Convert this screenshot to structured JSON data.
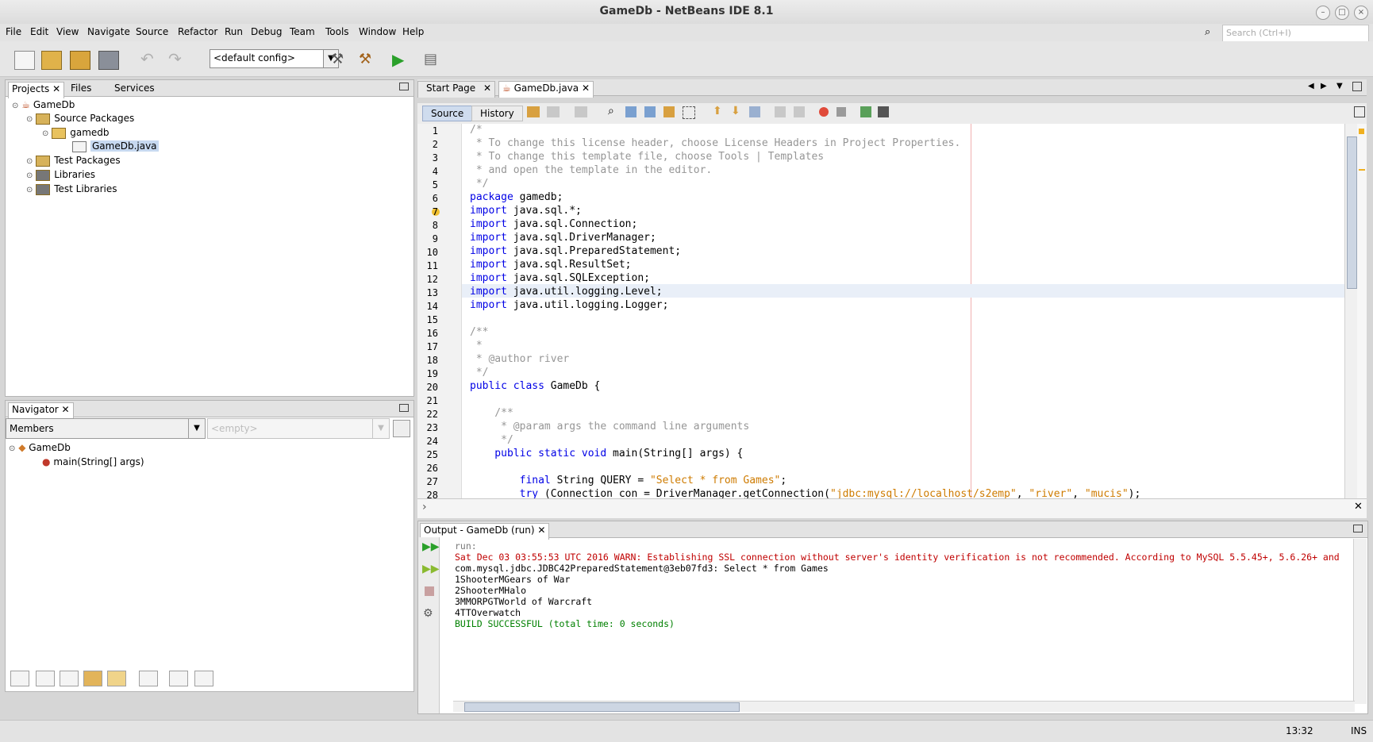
{
  "window": {
    "title": "GameDb - NetBeans IDE 8.1"
  },
  "menu": [
    "File",
    "Edit",
    "View",
    "Navigate",
    "Source",
    "Refactor",
    "Run",
    "Debug",
    "Team",
    "Tools",
    "Window",
    "Help"
  ],
  "search": {
    "placeholder": "Search (Ctrl+I)"
  },
  "toolbar": {
    "config": "<default config>"
  },
  "projects_panel": {
    "tabs": [
      "Projects",
      "Files",
      "Services"
    ],
    "tree": [
      "GameDb",
      "Source Packages",
      "gamedb",
      "GameDb.java",
      "Test Packages",
      "Libraries",
      "Test Libraries"
    ]
  },
  "navigator": {
    "title": "Navigator",
    "filter": "Members",
    "empty": "<empty>",
    "tree": [
      "GameDb",
      "main(String[] args)"
    ]
  },
  "editor": {
    "tabs": [
      "Start Page",
      "GameDb.java"
    ],
    "modes": [
      "Source",
      "History"
    ],
    "line_numbers": [
      "1",
      "2",
      "3",
      "4",
      "5",
      "6",
      "7",
      "8",
      "9",
      "10",
      "11",
      "12",
      "13",
      "14",
      "15",
      "16",
      "17",
      "18",
      "19",
      "20",
      "21",
      "22",
      "23",
      "24",
      "25",
      "26",
      "27",
      "28"
    ]
  },
  "code": [
    [
      {
        "t": "/*",
        "c": "cm"
      }
    ],
    [
      {
        "t": " * To change this license header, choose License Headers in Project Properties.",
        "c": "cm"
      }
    ],
    [
      {
        "t": " * To change this template file, choose Tools | Templates",
        "c": "cm"
      }
    ],
    [
      {
        "t": " * and open the template in the editor.",
        "c": "cm"
      }
    ],
    [
      {
        "t": " */",
        "c": "cm"
      }
    ],
    [
      {
        "t": "package",
        "c": "kw"
      },
      {
        "t": " gamedb;",
        "c": ""
      }
    ],
    [
      {
        "t": "import",
        "c": "kw"
      },
      {
        "t": " java.sql.*;",
        "c": ""
      }
    ],
    [
      {
        "t": "import",
        "c": "kw"
      },
      {
        "t": " java.sql.Connection;",
        "c": ""
      }
    ],
    [
      {
        "t": "import",
        "c": "kw"
      },
      {
        "t": " java.sql.DriverManager;",
        "c": ""
      }
    ],
    [
      {
        "t": "import",
        "c": "kw"
      },
      {
        "t": " java.sql.PreparedStatement;",
        "c": ""
      }
    ],
    [
      {
        "t": "import",
        "c": "kw"
      },
      {
        "t": " java.sql.ResultSet;",
        "c": ""
      }
    ],
    [
      {
        "t": "import",
        "c": "kw"
      },
      {
        "t": " java.sql.SQLException;",
        "c": ""
      }
    ],
    [
      {
        "t": "import",
        "c": "kw"
      },
      {
        "t": " java.util.logging.Level;",
        "c": ""
      }
    ],
    [
      {
        "t": "import",
        "c": "kw"
      },
      {
        "t": " java.util.logging.Logger;",
        "c": ""
      }
    ],
    [],
    [
      {
        "t": "/**",
        "c": "cm"
      }
    ],
    [
      {
        "t": " *",
        "c": "cm"
      }
    ],
    [
      {
        "t": " * @author river",
        "c": "cm"
      }
    ],
    [
      {
        "t": " */",
        "c": "cm"
      }
    ],
    [
      {
        "t": "public class",
        "c": "kw"
      },
      {
        "t": " GameDb {",
        "c": ""
      }
    ],
    [],
    [
      {
        "t": "    /**",
        "c": "cm"
      }
    ],
    [
      {
        "t": "     * @param args the command line arguments",
        "c": "cm"
      }
    ],
    [
      {
        "t": "     */",
        "c": "cm"
      }
    ],
    [
      {
        "t": "    public static void",
        "c": "kw"
      },
      {
        "t": " main(String[] args) {",
        "c": ""
      }
    ],
    [],
    [
      {
        "t": "        final",
        "c": "kw"
      },
      {
        "t": " String QUERY = ",
        "c": ""
      },
      {
        "t": "\"Select * from Games\"",
        "c": "st"
      },
      {
        "t": ";",
        "c": ""
      }
    ],
    [
      {
        "t": "        try",
        "c": "kw"
      },
      {
        "t": " (Connection con = DriverManager.getConnection(",
        "c": ""
      },
      {
        "t": "\"jdbc:mysql://localhost/s2emp\"",
        "c": "st"
      },
      {
        "t": ", ",
        "c": ""
      },
      {
        "t": "\"river\"",
        "c": "st"
      },
      {
        "t": ", ",
        "c": ""
      },
      {
        "t": "\"mucis\"",
        "c": "st"
      },
      {
        "t": ");",
        "c": ""
      }
    ]
  ],
  "output": {
    "title": "Output - GameDb (run)",
    "lines": [
      {
        "t": "run:",
        "c": "#7a7a7a"
      },
      {
        "t": "Sat Dec 03 03:55:53 UTC 2016 WARN: Establishing SSL connection without server's identity verification is not recommended. According to MySQL 5.5.45+, 5.6.26+ and",
        "c": "#c00000"
      },
      {
        "t": "com.mysql.jdbc.JDBC42PreparedStatement@3eb07fd3: Select * from Games",
        "c": "#000000"
      },
      {
        "t": "1ShooterMGears of War",
        "c": "#000000"
      },
      {
        "t": "2ShooterMHalo",
        "c": "#000000"
      },
      {
        "t": "3MMORPGTWorld of Warcraft",
        "c": "#000000"
      },
      {
        "t": "4TTOverwatch",
        "c": "#000000"
      },
      {
        "t": "BUILD SUCCESSFUL (total time: 0 seconds)",
        "c": "#008000"
      }
    ]
  },
  "status": {
    "position": "13:32",
    "mode": "INS"
  }
}
